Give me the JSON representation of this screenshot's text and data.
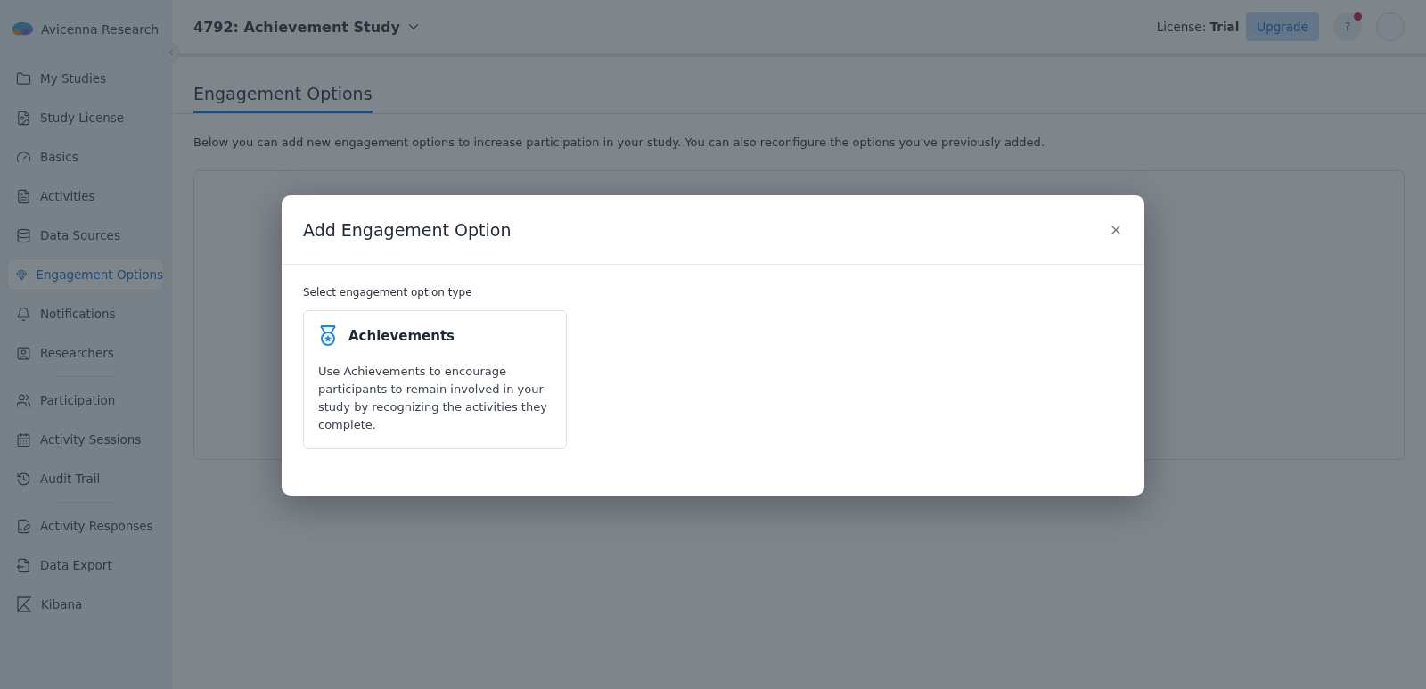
{
  "brand": {
    "name": "Avicenna Research"
  },
  "sidebar": {
    "groups": [
      [
        {
          "label": "My Studies",
          "selected": false
        },
        {
          "label": "Study License",
          "selected": false
        },
        {
          "label": "Basics",
          "selected": false
        },
        {
          "label": "Activities",
          "selected": false
        },
        {
          "label": "Data Sources",
          "selected": false
        },
        {
          "label": "Engagement Options",
          "selected": true
        },
        {
          "label": "Notifications",
          "selected": false
        },
        {
          "label": "Researchers",
          "selected": false
        }
      ],
      [
        {
          "label": "Participation",
          "selected": false
        },
        {
          "label": "Activity Sessions",
          "selected": false
        },
        {
          "label": "Audit Trail",
          "selected": false
        }
      ],
      [
        {
          "label": "Activity Responses",
          "selected": false
        },
        {
          "label": "Data Export",
          "selected": false
        },
        {
          "label": "Kibana",
          "selected": false
        }
      ]
    ]
  },
  "header": {
    "study_title": "4792: Achievement Study",
    "license_label": "License:",
    "license_value": "Trial",
    "upgrade_button": "Upgrade",
    "help_button": "?",
    "help_notification": true
  },
  "page": {
    "tabs": [
      {
        "label": "Engagement Options",
        "selected": true
      }
    ],
    "description": "Below you can add new engagement options to increase participation in your study. You can also reconfigure the options you've previously added."
  },
  "modal": {
    "title": "Add Engagement Option",
    "prompt": "Select engagement option type",
    "options": [
      {
        "title": "Achievements",
        "description": "Use Achievements to encourage participants to remain involved in your study by recognizing the activities they complete."
      }
    ]
  }
}
